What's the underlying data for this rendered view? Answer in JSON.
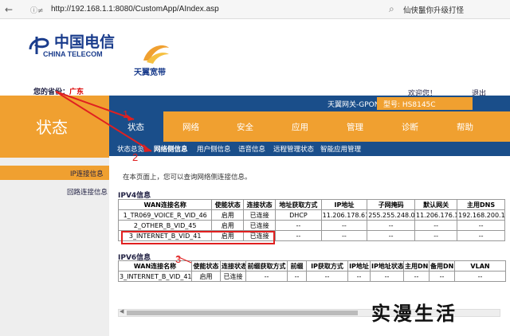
{
  "browser": {
    "url": "http://192.168.1.1:8080/CustomApp/AIndex.asp",
    "search_text": "仙侠鬣你升级打怪",
    "back_icon": "back-arrow-icon",
    "lock_icon": "unsecure-icon"
  },
  "header": {
    "brand_cn": "中国电信",
    "brand_en": "CHINA TELECOM",
    "sub_brand": "天翼宽带",
    "province_label": "您的省份：",
    "province_value": "广东",
    "welcome": "欢迎您！",
    "logout": "退出"
  },
  "topbar": {
    "gateway": "天翼网关-GPON",
    "model_label": "型号: HS8145C"
  },
  "status_title": "状态",
  "menu": {
    "items": [
      "状态",
      "网络",
      "安全",
      "应用",
      "管理",
      "诊断",
      "帮助"
    ]
  },
  "submenu": {
    "items": [
      "状态总览",
      "网络侧信息",
      "用户侧信息",
      "语音信息",
      "远程管理状态",
      "智能应用管理"
    ]
  },
  "sidebar": {
    "items": [
      "IP连接信息",
      "回路连接信息"
    ]
  },
  "content": {
    "info_text": "在本页面上，您可以查询网络侧连接信息。",
    "ipv4_title": "IPV4信息",
    "ipv6_title": "IPV6信息",
    "ipv4_table": {
      "headers": [
        "WAN连接名称",
        "使能状态",
        "连接状态",
        "地址获取方式",
        "IP地址",
        "子网掩码",
        "默认网关",
        "主用DNS"
      ],
      "rows": [
        [
          "1_TR069_VOICE_R_VID_46",
          "启用",
          "已连接",
          "DHCP",
          "11.206.178.61",
          "255.255.248.0",
          "11.206.176.1",
          "192.168.200.1"
        ],
        [
          "2_OTHER_B_VID_45",
          "启用",
          "已连接",
          "--",
          "--",
          "--",
          "--",
          "--"
        ],
        [
          "3_INTERNET_B_VID_41",
          "启用",
          "已连接",
          "--",
          "--",
          "--",
          "--",
          "--"
        ]
      ]
    },
    "ipv6_table": {
      "headers": [
        "WAN连接名称",
        "使能状态",
        "连接状态",
        "前缀获取方式",
        "前缀",
        "IP获取方式",
        "IP地址",
        "IP地址状态",
        "主用DNS",
        "备用DNS",
        "VLAN"
      ],
      "rows": [
        [
          "3_INTERNET_B_VID_41",
          "启用",
          "已连接",
          "--",
          "--",
          "--",
          "--",
          "--",
          "--",
          "--",
          "--"
        ]
      ]
    }
  },
  "annotations": {
    "n1": "1",
    "n2": "2",
    "n3": "3",
    "accent": "#e02020"
  },
  "watermark": "实漫生活"
}
